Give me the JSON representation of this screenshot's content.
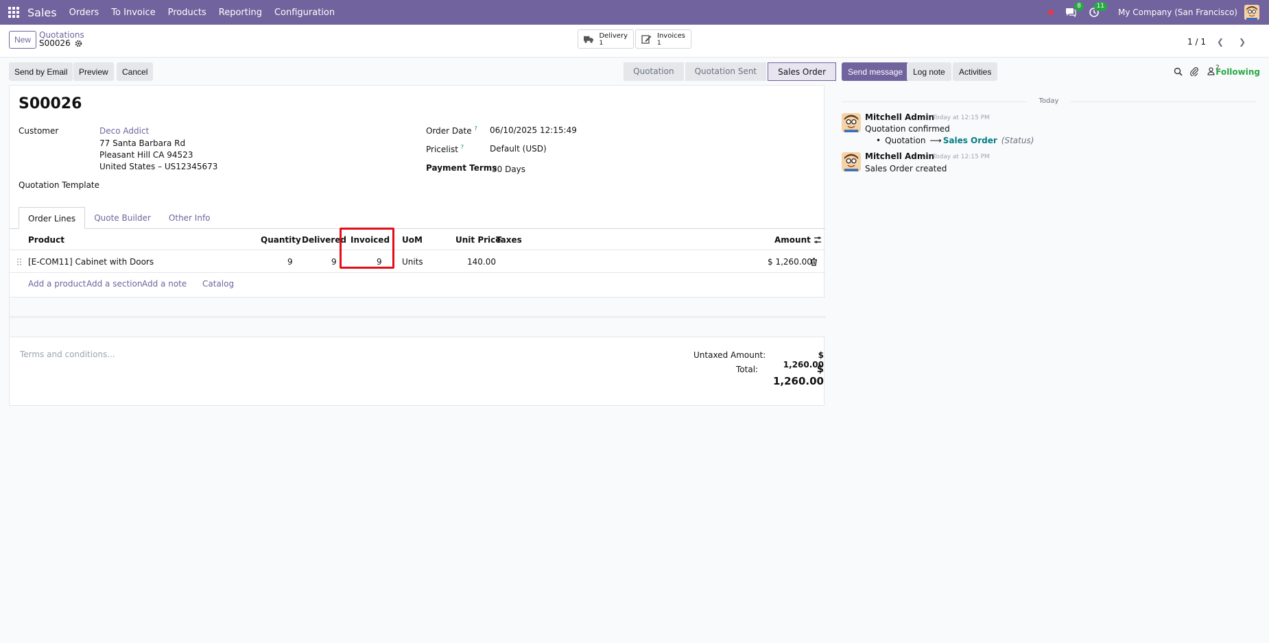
{
  "topbar": {
    "app": "Sales",
    "menu": [
      "Orders",
      "To Invoice",
      "Products",
      "Reporting",
      "Configuration"
    ],
    "chat_badge": "8",
    "activity_badge": "11",
    "company": "My Company (San Francisco)"
  },
  "control": {
    "new_label": "New",
    "breadcrumb_parent": "Quotations",
    "breadcrumb_current": "S00026",
    "smart_buttons": [
      {
        "label": "Delivery",
        "count": "1"
      },
      {
        "label": "Invoices",
        "count": "1"
      }
    ],
    "pager": "1 / 1"
  },
  "actions": {
    "send_email": "Send by Email",
    "preview": "Preview",
    "cancel": "Cancel",
    "statusbar": [
      "Quotation",
      "Quotation Sent",
      "Sales Order"
    ]
  },
  "form": {
    "title": "S00026",
    "customer_label": "Customer",
    "customer_name": "Deco Addict",
    "address_lines": [
      "77 Santa Barbara Rd",
      "Pleasant Hill CA 94523",
      "United States – US12345673"
    ],
    "template_label": "Quotation Template",
    "order_date_label": "Order Date",
    "order_date": "06/10/2025 12:15:49",
    "pricelist_label": "Pricelist",
    "pricelist": "Default (USD)",
    "payment_terms_label": "Payment Terms",
    "payment_terms": "30 Days",
    "help_mark": "?",
    "tabs": [
      "Order Lines",
      "Quote Builder",
      "Other Info"
    ],
    "columns": {
      "product": "Product",
      "quantity": "Quantity",
      "delivered": "Delivered",
      "invoiced": "Invoiced",
      "uom": "UoM",
      "unit_price": "Unit Price",
      "taxes": "Taxes",
      "amount": "Amount"
    },
    "lines": [
      {
        "product": "[E-COM11] Cabinet with Doors",
        "quantity": "9",
        "delivered": "9",
        "invoiced": "9",
        "uom": "Units",
        "unit_price": "140.00",
        "taxes": "",
        "amount": "$ 1,260.00"
      }
    ],
    "add_links": [
      "Add a product",
      "Add a section",
      "Add a note",
      "Catalog"
    ],
    "terms_placeholder": "Terms and conditions...",
    "untaxed_label": "Untaxed Amount:",
    "untaxed_value": "$ 1,260.00",
    "total_label": "Total:",
    "total_value": "$ 1,260.00"
  },
  "chatter": {
    "send_message": "Send message",
    "log_note": "Log note",
    "activities": "Activities",
    "followers_count": "2",
    "following": "Following",
    "date_sep": "Today",
    "messages": [
      {
        "author": "Mitchell Admin",
        "time": "Today at 12:15 PM",
        "body": "Quotation confirmed",
        "tracking_from": "Quotation",
        "tracking_arrow": "⟶",
        "tracking_to": "Sales Order",
        "tracking_field": "(Status)"
      },
      {
        "author": "Mitchell Admin",
        "time": "Today at 12:15 PM",
        "body": "Sales Order created"
      }
    ]
  },
  "colors": {
    "brand": "#71639e",
    "highlight": "#e30d17",
    "following": "#28a745"
  }
}
